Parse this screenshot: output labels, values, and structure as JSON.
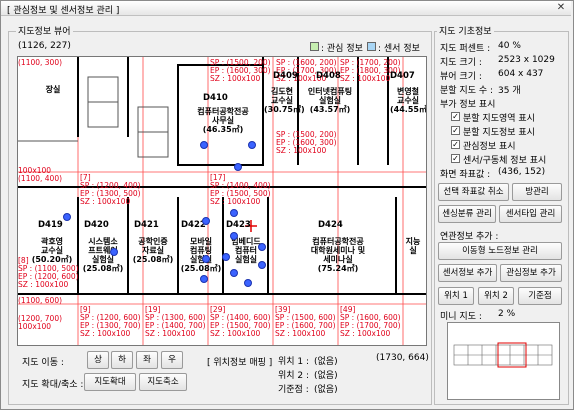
{
  "window": {
    "title": "[ 관심정보 및 센서정보 관리 ]",
    "close": "✕"
  },
  "viewer": {
    "group_label": "지도정보 뷰어",
    "coord": "(1126, 227)",
    "legend": [
      {
        "label": ": 관심 정보",
        "color": "#c6efb0"
      },
      {
        "label": ": 센서 정보",
        "color": "#a9d6f5"
      }
    ],
    "cell_labels": [
      {
        "sp": "SP : (1500, 200)",
        "ep": "EP : (1600, 300)",
        "sz": "SZ : 100x100"
      },
      {
        "sp": "SP : (1600, 200)",
        "ep": "EP : (1700, 300)",
        "sz": "SZ : 100x100"
      },
      {
        "sp": "SP : (1700, 200)",
        "ep": "EP : (1800, 300)",
        "sz": "SZ : 100x100"
      }
    ],
    "cells": [
      {
        "n": "[7]",
        "sp": "SP : (1200, 400)",
        "ep": "EP : (1300, 500)",
        "sz": "SZ : 100x100"
      },
      {
        "n": "[17]",
        "sp": "SP : (1400, 400)",
        "ep": "EP : (1500, 500)",
        "sz": "SZ : 100x100"
      },
      {
        "n": "[8]",
        "sp": "SP : (1100, 500)",
        "ep": "EP : (1200, 600)",
        "sz": "SZ : 100x100"
      },
      {
        "n": "[9]",
        "sp": "SP : (1200, 600)",
        "ep": "EP : (1300, 700)",
        "sz": "SZ : 100x100"
      },
      {
        "n": "[19]",
        "sp": "SP : (1300, 600)",
        "ep": "EP : (1400, 700)",
        "sz": "SZ : 100x100"
      },
      {
        "n": "[29]",
        "sp": "SP : (1400, 600)",
        "ep": "EP : (1500, 700)",
        "sz": "SZ : 100x100"
      },
      {
        "n": "[39]",
        "sp": "SP : (1500, 600)",
        "ep": "EP : (1600, 700)",
        "sz": "SZ : 100x100"
      },
      {
        "n": "[49]",
        "sp": "SP : (1600, 600)",
        "ep": "EP : (1700, 700)",
        "sz": "SZ : 100x100"
      }
    ],
    "left_col": [
      "(1100, 300)",
      "100x100",
      "(1100, 400)",
      "100x100",
      "(1100, 600)",
      "(1200, 700)",
      "100x100"
    ],
    "rooms": [
      {
        "id": "D410",
        "name": "컴퓨터공학전공\n사무실\n(46.35㎡)"
      },
      {
        "id": "D409",
        "name": "김도현\n교수실\n(30.75㎡)"
      },
      {
        "id": "D408",
        "name": "인터넷컴퓨팅\n실험실\n(43.57㎡)"
      },
      {
        "id": "D407",
        "name": "변영철\n교수실\n(44.55㎡)"
      },
      {
        "id": "D419",
        "name": "곽호영\n교수실\n(50.20㎡)"
      },
      {
        "id": "D420",
        "name": "시스템소\n프트웨어\n실험실\n(25.08㎡)"
      },
      {
        "id": "D421",
        "name": "공학인증\n자료실\n(25.08㎡)"
      },
      {
        "id": "D422",
        "name": "모바일\n컴퓨팅\n실험실\n(25.08㎡)"
      },
      {
        "id": "D423",
        "name": "임베디드\n컴퓨터\n실험실"
      },
      {
        "id": "D424",
        "name": "컴퓨터공학전공\n대학원세미나 및\n세미나실\n(75.24㎡)"
      },
      {
        "id": "",
        "name": "지능\n실"
      },
      {
        "id": "",
        "name": "장실"
      }
    ],
    "position_readout": "(1730, 664)"
  },
  "nav": {
    "move_label": "지도 이동 :",
    "up": "상",
    "down": "하",
    "left": "좌",
    "right": "우",
    "zoom_label": "지도 확대/축소 :",
    "zoom_in": "지도확대",
    "zoom_out": "지도축소"
  },
  "mapping": {
    "title": "[ 위치정보 매핑 ]",
    "pos1_label": "위치 1 :",
    "pos1_value": "(없음)",
    "pos2_label": "위치 2 :",
    "pos2_value": "(없음)",
    "base_label": "기준점 :",
    "base_value": "(없음)"
  },
  "info": {
    "group_label": "지도 기초정보",
    "rows": [
      {
        "k": "지도 퍼센트 :",
        "v": "40 %"
      },
      {
        "k": "지도 크기 :",
        "v": "2523 x 1029"
      },
      {
        "k": "뷰어 크기 :",
        "v": "604 x 437"
      },
      {
        "k": "분할 지도 수 :",
        "v": "35 개"
      }
    ],
    "extra_label": "부가 정보 표시",
    "checks": [
      {
        "label": "분할 지도영역 표시",
        "checked": "✓"
      },
      {
        "label": "분할 지도정보 표시",
        "checked": "✓"
      },
      {
        "label": "관심정보 표시",
        "checked": "✓"
      },
      {
        "label": "센서/구동체 정보 표시",
        "checked": "✓"
      }
    ],
    "screen_coord_label": "화면 좌표값 :",
    "screen_coord_value": "(436, 152)"
  },
  "buttons": {
    "cancel_select": "선택 좌표값 취소",
    "room_list": "방관리",
    "sensor_type": "센싱분류 관리",
    "sensor_model": "센서타입 관리",
    "link_label": "연관정보 추가 :",
    "mover_node": "이동형 노드정보 관리",
    "add_sensor": "센서정보 추가",
    "add_interest": "관심정보 추가",
    "pos1": "위치 1",
    "pos2": "위치 2",
    "base": "기준점"
  },
  "mini": {
    "label": "미니 지도 :",
    "percent": "2 %"
  }
}
